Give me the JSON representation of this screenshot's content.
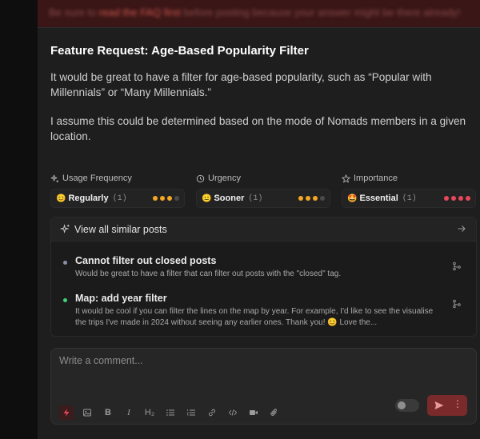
{
  "banner": {
    "text_before": "Be sure to ",
    "link": "read the FAQ first",
    "text_after": " before posting because your answer might be there already!"
  },
  "post": {
    "title": "Feature Request: Age-Based Popularity Filter",
    "body": [
      "It would be great to have a filter for age-based popularity, such as “Popular with Millennials” or “Many Millennials.”",
      "I assume this could be determined based on the mode of Nomads members in a given location."
    ]
  },
  "metrics": [
    {
      "label": "Usage Frequency",
      "icon": "sparkle-icon",
      "emoji": "😊",
      "value": "Regularly",
      "count": "(1)",
      "level": 3,
      "max": 4,
      "color": "#f5a623"
    },
    {
      "label": "Urgency",
      "icon": "clock-icon",
      "emoji": "😐",
      "value": "Sooner",
      "count": "(1)",
      "level": 3,
      "max": 4,
      "color": "#f5a623"
    },
    {
      "label": "Importance",
      "icon": "star-icon",
      "emoji": "🤩",
      "value": "Essential",
      "count": "(1)",
      "level": 4,
      "max": 4,
      "color": "#e8475b"
    }
  ],
  "similar": {
    "heading": "View all similar posts",
    "items": [
      {
        "title": "Cannot filter out closed posts",
        "desc": "Would be great to have a filter that can filter out posts with the \"closed\" tag.",
        "status_color": "#8a8fa8"
      },
      {
        "title": "Map: add year filter",
        "desc": "It would be cool if you can filter the lines on the map by year. For example, I'd like to see the visualise the trips I've made in 2024 without seeing any earlier ones. Thank you! 😊 Love the...",
        "status_color": "#3fd17a"
      }
    ]
  },
  "comment": {
    "placeholder": "Write a comment..."
  },
  "toolbar": {
    "bold": "B",
    "italic": "I",
    "heading": "H₂"
  },
  "colors": {
    "accent": "#e8475b",
    "submit_bg": "#7a2a2a"
  }
}
